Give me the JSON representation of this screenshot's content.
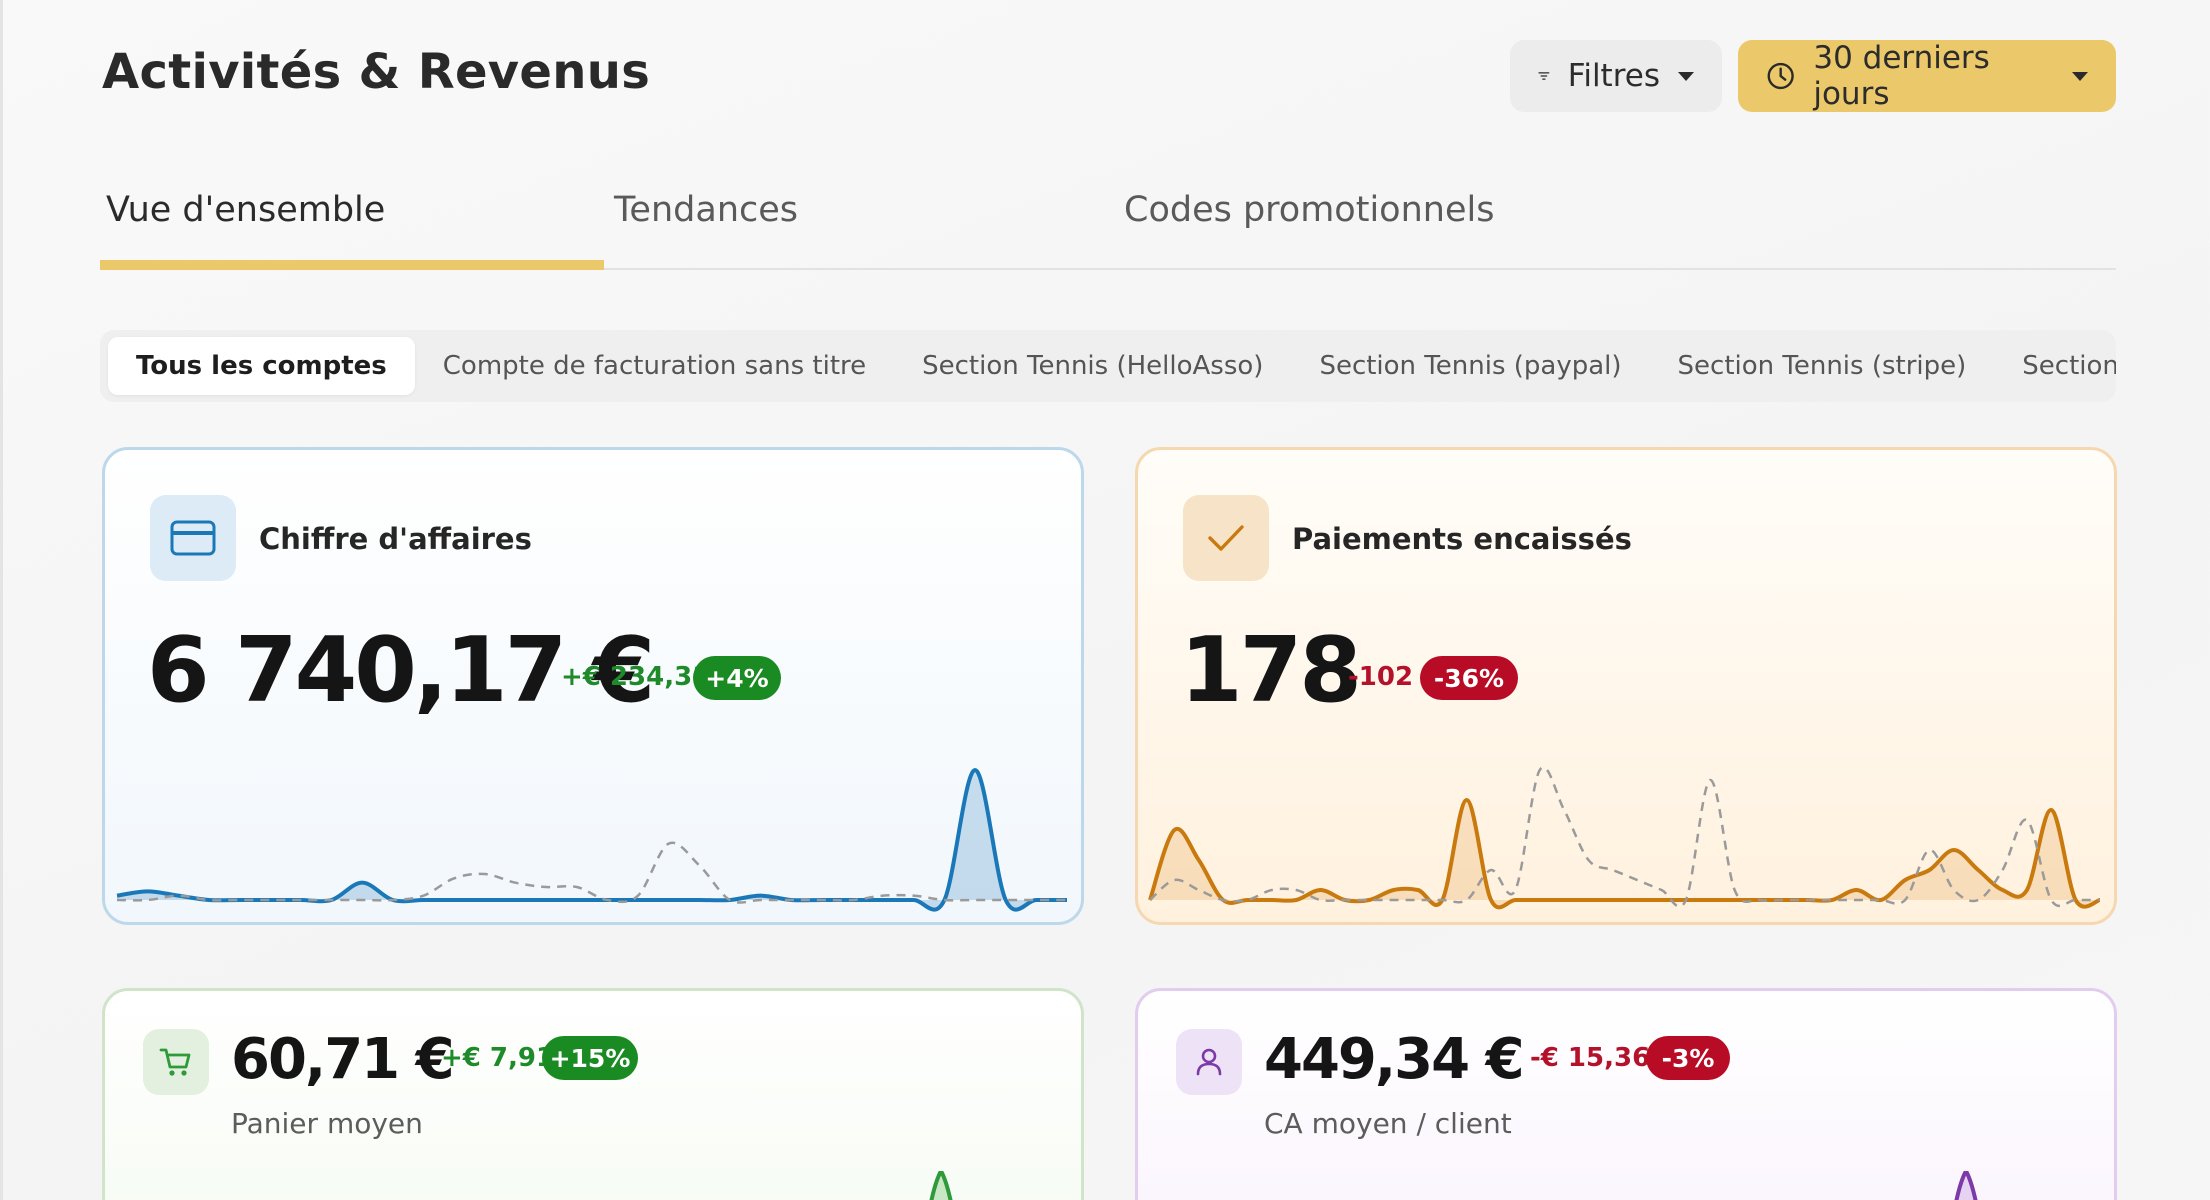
{
  "header": {
    "title": "Activités & Revenus",
    "filter_label": "Filtres",
    "period_label": "30 derniers jours"
  },
  "tabs": [
    {
      "label": "Vue d'ensemble",
      "active": true
    },
    {
      "label": "Tendances",
      "active": false
    },
    {
      "label": "Codes promotionnels",
      "active": false
    }
  ],
  "accounts": [
    {
      "label": "Tous les comptes",
      "active": true
    },
    {
      "label": "Compte de facturation sans titre",
      "active": false
    },
    {
      "label": "Section Tennis (HelloAsso)",
      "active": false
    },
    {
      "label": "Section Tennis (paypal)",
      "active": false
    },
    {
      "label": "Section Tennis (stripe)",
      "active": false
    },
    {
      "label": "Section Tennis (Sum",
      "active": false
    }
  ],
  "cards": {
    "revenue": {
      "title": "Chiffre d'affaires",
      "icon": "credit-card-icon",
      "value": "6 740,17 €",
      "delta": "+€ 234,31",
      "delta_pct": "+4%",
      "trend": "up",
      "color": "#1a78b8"
    },
    "payments": {
      "title": "Paiements encaissés",
      "icon": "check-icon",
      "value": "178",
      "delta": "-102",
      "delta_pct": "-36%",
      "trend": "down",
      "color": "#c97a0e"
    },
    "basket": {
      "label": "Panier moyen",
      "icon": "cart-icon",
      "value": "60,71 €",
      "delta": "+€ 7,91",
      "delta_pct": "+15%",
      "trend": "up",
      "color": "#2e9a3a"
    },
    "per_client": {
      "label": "CA moyen / client",
      "icon": "user-icon",
      "value": "449,34 €",
      "delta": "-€ 15,36",
      "delta_pct": "-3%",
      "trend": "down",
      "color": "#7b3aa8"
    }
  },
  "colors": {
    "accent": "#ebc96b",
    "positive": "#1a8a22",
    "negative": "#b80b25"
  },
  "chart_data": [
    {
      "type": "area",
      "series": [
        {
          "values": [
            1,
            2,
            1,
            0,
            0,
            0,
            0,
            0,
            4,
            0,
            0,
            0,
            0,
            0,
            0,
            0,
            0,
            0,
            0,
            0,
            0,
            1,
            0,
            0,
            0,
            0,
            0,
            0,
            30,
            0,
            0,
            0
          ]
        },
        {
          "values": [
            0,
            0,
            1,
            0,
            0,
            0,
            0,
            0,
            0,
            0,
            1,
            5,
            6,
            4,
            3,
            3,
            0,
            1,
            13,
            8,
            0,
            0,
            0,
            0,
            0,
            1,
            1,
            0,
            0,
            0,
            0,
            0
          ],
          "style": "dashed"
        }
      ]
    },
    {
      "type": "area",
      "series": [
        {
          "values": [
            0,
            7,
            4,
            0,
            0,
            0,
            0,
            1,
            0,
            0,
            1,
            1,
            0,
            10,
            0,
            0,
            0,
            0,
            0,
            0,
            0,
            0,
            0,
            0,
            0,
            0,
            0,
            0,
            0,
            1,
            0,
            2,
            3,
            5,
            3,
            1,
            1,
            9,
            0,
            0
          ]
        },
        {
          "values": [
            0,
            2,
            1,
            0,
            0,
            1,
            1,
            0,
            0,
            0,
            0,
            0,
            0,
            0,
            3,
            1,
            13,
            9,
            4,
            3,
            2,
            1,
            0,
            12,
            1,
            0,
            0,
            0,
            0,
            0,
            0,
            0,
            5,
            1,
            0,
            3,
            8,
            0,
            0,
            0
          ],
          "style": "dashed"
        }
      ]
    }
  ]
}
